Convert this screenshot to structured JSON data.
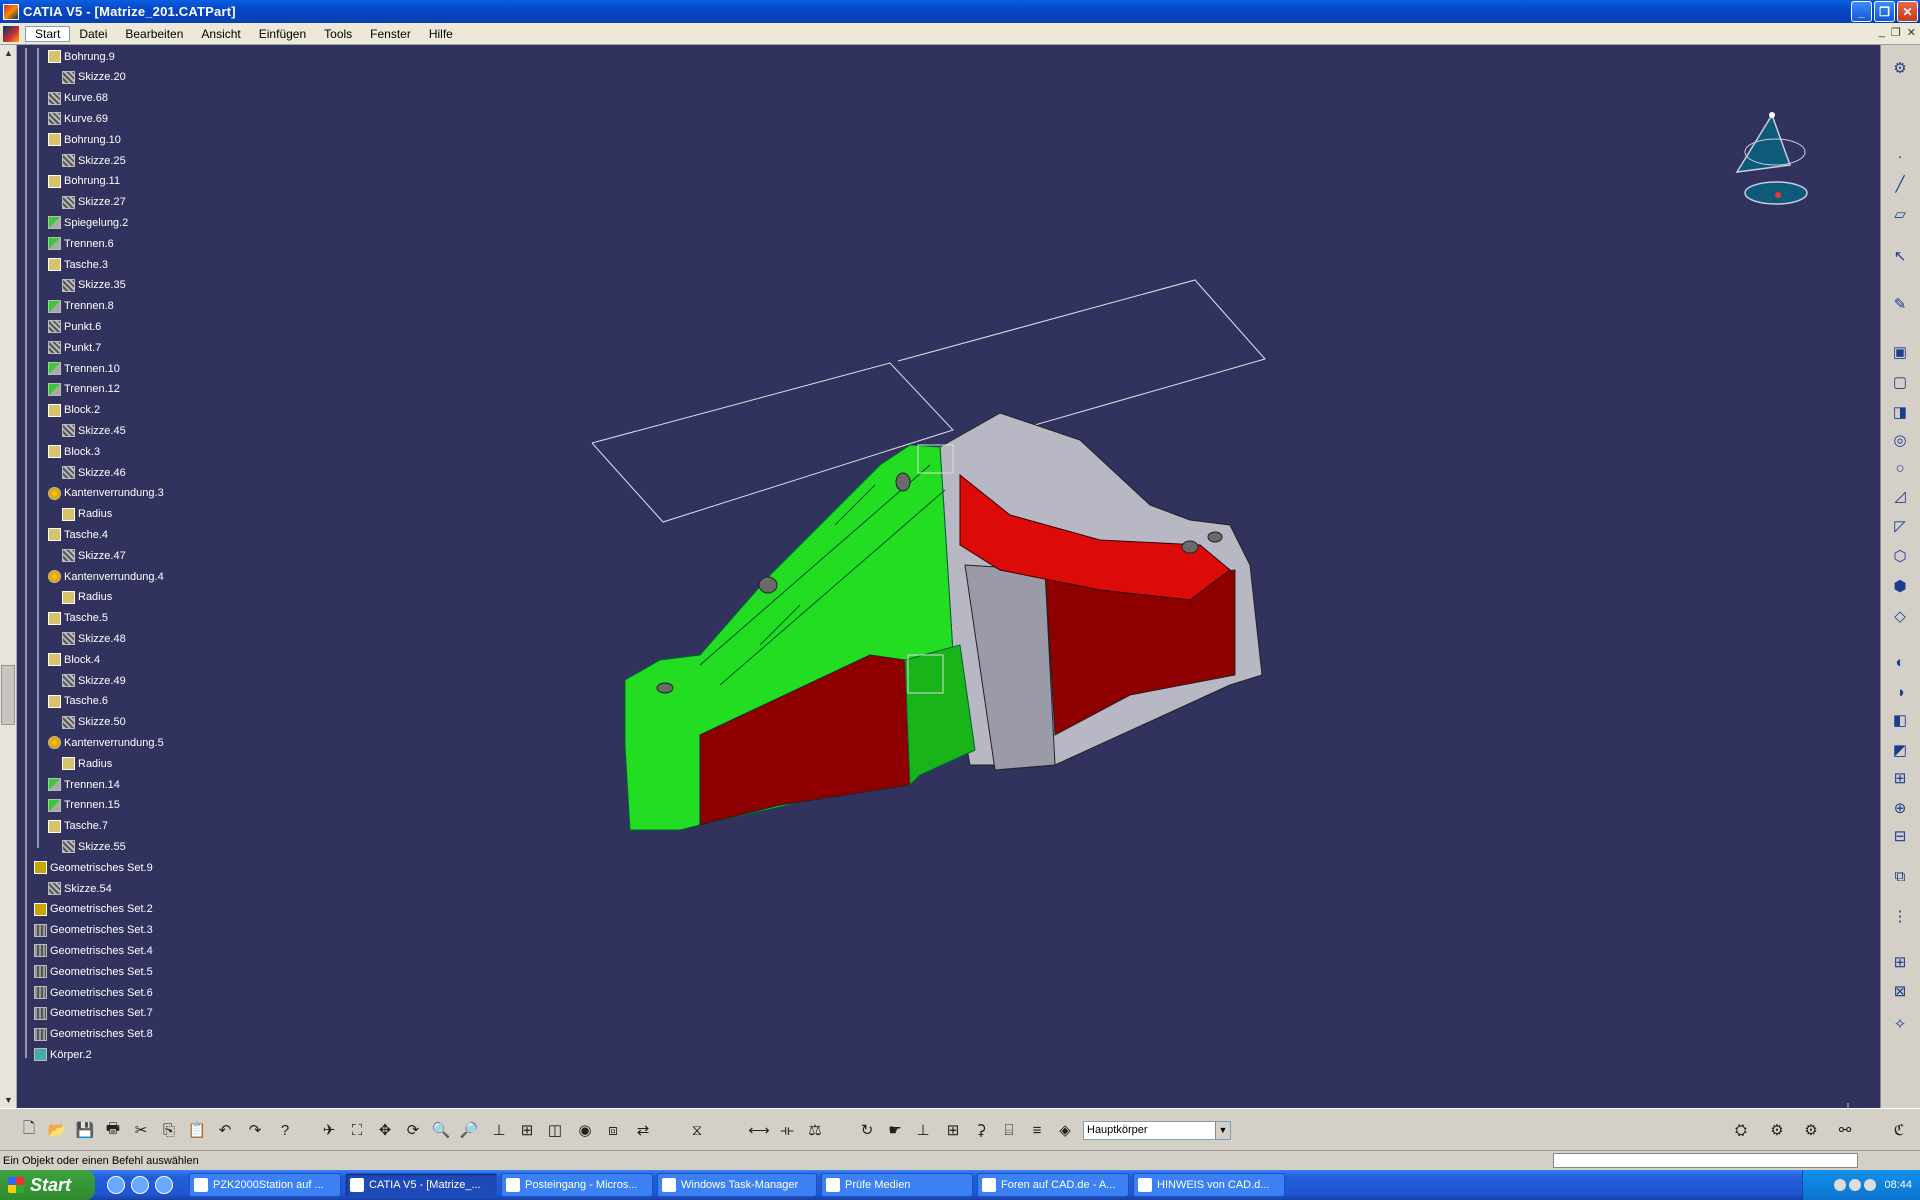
{
  "window": {
    "title": "CATIA V5 - [Matrize_201.CATPart]"
  },
  "menu": [
    "Start",
    "Datei",
    "Bearbeiten",
    "Ansicht",
    "Einfügen",
    "Tools",
    "Fenster",
    "Hilfe"
  ],
  "tree": [
    {
      "label": "Bohrung.9",
      "icon": "feature"
    },
    {
      "label": "Skizze.20",
      "icon": "sketch"
    },
    {
      "label": "Kurve.68",
      "icon": "sketch"
    },
    {
      "label": "Kurve.69",
      "icon": "sketch"
    },
    {
      "label": "Bohrung.10",
      "icon": "feature"
    },
    {
      "label": "Skizze.25",
      "icon": "sketch"
    },
    {
      "label": "Bohrung.11",
      "icon": "feature"
    },
    {
      "label": "Skizze.27",
      "icon": "sketch"
    },
    {
      "label": "Spiegelung.2",
      "icon": "split"
    },
    {
      "label": "Trennen.6",
      "icon": "split"
    },
    {
      "label": "Tasche.3",
      "icon": "feature"
    },
    {
      "label": "Skizze.35",
      "icon": "sketch"
    },
    {
      "label": "Trennen.8",
      "icon": "split"
    },
    {
      "label": "Punkt.6",
      "icon": "sketch"
    },
    {
      "label": "Punkt.7",
      "icon": "sketch"
    },
    {
      "label": "Trennen.10",
      "icon": "split"
    },
    {
      "label": "Trennen.12",
      "icon": "split"
    },
    {
      "label": "Block.2",
      "icon": "feature"
    },
    {
      "label": "Skizze.45",
      "icon": "sketch"
    },
    {
      "label": "Block.3",
      "icon": "feature"
    },
    {
      "label": "Skizze.46",
      "icon": "sketch"
    },
    {
      "label": "Kantenverrundung.3",
      "icon": "fillet"
    },
    {
      "label": "Radius",
      "icon": "feature"
    },
    {
      "label": "Tasche.4",
      "icon": "feature"
    },
    {
      "label": "Skizze.47",
      "icon": "sketch"
    },
    {
      "label": "Kantenverrundung.4",
      "icon": "fillet"
    },
    {
      "label": "Radius",
      "icon": "feature"
    },
    {
      "label": "Tasche.5",
      "icon": "feature"
    },
    {
      "label": "Skizze.48",
      "icon": "sketch"
    },
    {
      "label": "Block.4",
      "icon": "feature"
    },
    {
      "label": "Skizze.49",
      "icon": "sketch"
    },
    {
      "label": "Tasche.6",
      "icon": "feature"
    },
    {
      "label": "Skizze.50",
      "icon": "sketch"
    },
    {
      "label": "Kantenverrundung.5",
      "icon": "fillet"
    },
    {
      "label": "Radius",
      "icon": "feature"
    },
    {
      "label": "Trennen.14",
      "icon": "split"
    },
    {
      "label": "Trennen.15",
      "icon": "split"
    },
    {
      "label": "Tasche.7",
      "icon": "feature"
    },
    {
      "label": "Skizze.55",
      "icon": "sketch"
    },
    {
      "label": "Geometrisches Set.9",
      "icon": "gset"
    },
    {
      "label": "Skizze.54",
      "icon": "sketch"
    },
    {
      "label": "Geometrisches Set.2",
      "icon": "gset"
    },
    {
      "label": "Geometrisches Set.3",
      "icon": "gset2"
    },
    {
      "label": "Geometrisches Set.4",
      "icon": "gset2"
    },
    {
      "label": "Geometrisches Set.5",
      "icon": "gset2"
    },
    {
      "label": "Geometrisches Set.6",
      "icon": "gset2"
    },
    {
      "label": "Geometrisches Set.7",
      "icon": "gset2"
    },
    {
      "label": "Geometrisches Set.8",
      "icon": "gset2"
    },
    {
      "label": "Körper.2",
      "icon": "body"
    }
  ],
  "toolbar": {
    "body_select_value": "Hauptkörper"
  },
  "status": {
    "message": "Ein Objekt oder einen Befehl auswählen"
  },
  "taskbar": {
    "start_label": "Start",
    "tasks": [
      {
        "label": "PZK2000Station auf ...",
        "active": false
      },
      {
        "label": "CATIA V5 - [Matrize_...",
        "active": true
      },
      {
        "label": "Posteingang - Micros...",
        "active": false
      },
      {
        "label": "Windows Task-Manager",
        "active": false
      },
      {
        "label": "Prüfe Medien",
        "active": false
      },
      {
        "label": "Foren auf CAD.de - A...",
        "active": false
      },
      {
        "label": "HINWEIS von CAD.d...",
        "active": false
      }
    ],
    "clock": "08:44"
  },
  "colors": {
    "viewport_bg": "#32325e",
    "part_green": "#22dd22",
    "part_red": "#990000",
    "part_grey": "#b0b0bc"
  }
}
